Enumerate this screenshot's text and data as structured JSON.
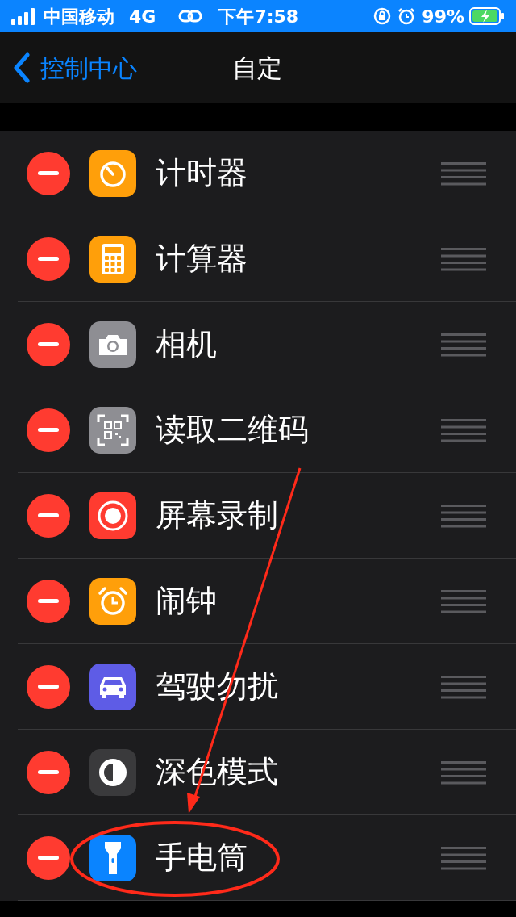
{
  "status_bar": {
    "carrier": "中国移动",
    "network": "4G",
    "time": "下午7:58",
    "battery": "99%"
  },
  "nav": {
    "back": "控制中心",
    "title": "自定"
  },
  "rows": [
    {
      "label": "计时器",
      "kind": "timer",
      "color": "#ff9f0a"
    },
    {
      "label": "计算器",
      "kind": "calculator",
      "color": "#ff9f0a"
    },
    {
      "label": "相机",
      "kind": "camera",
      "color": "#8e8e93"
    },
    {
      "label": "读取二维码",
      "kind": "qr",
      "color": "#8e8e93"
    },
    {
      "label": "屏幕录制",
      "kind": "record",
      "color": "#ff3b30"
    },
    {
      "label": "闹钟",
      "kind": "alarm",
      "color": "#ff9f0a"
    },
    {
      "label": "驾驶勿扰",
      "kind": "car",
      "color": "#5e5ce6"
    },
    {
      "label": "深色模式",
      "kind": "darkmode",
      "color": "#3a3a3c"
    },
    {
      "label": "手电筒",
      "kind": "flashlight",
      "color": "#0a84ff"
    }
  ]
}
